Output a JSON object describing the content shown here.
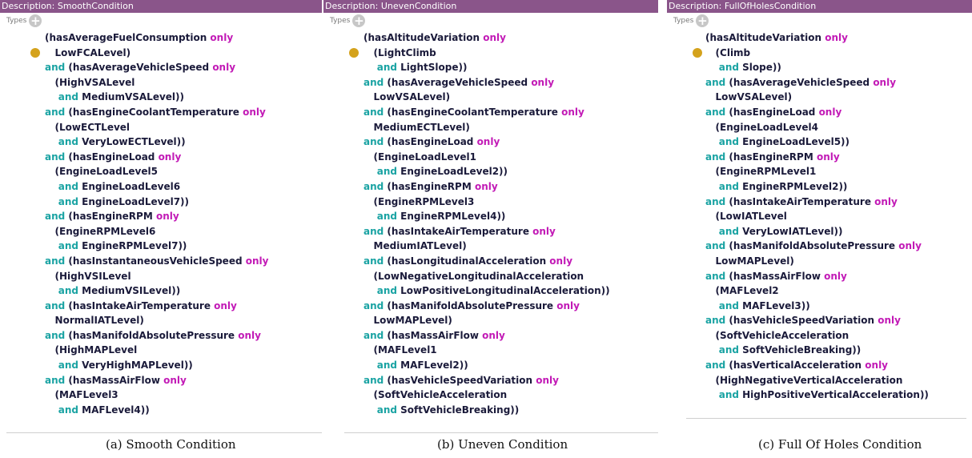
{
  "panels": [
    {
      "header": "Description: SmoothCondition",
      "types_label": "Types",
      "add_icon": "plus-circle-icon",
      "bullet_icon": "class-dot-icon",
      "lines": [
        [
          {
            "t": "(hasAverageFuelConsumption "
          },
          {
            "t": "only",
            "k": "only"
          }
        ],
        [
          {
            "t": "   LowFCALevel)"
          }
        ],
        [
          {
            "t": "and",
            "k": "and"
          },
          {
            "t": " (hasAverageVehicleSpeed "
          },
          {
            "t": "only",
            "k": "only"
          }
        ],
        [
          {
            "t": "   (HighVSALevel"
          }
        ],
        [
          {
            "t": "    "
          },
          {
            "t": "and",
            "k": "and"
          },
          {
            "t": " MediumVSALevel))"
          }
        ],
        [
          {
            "t": "and",
            "k": "and"
          },
          {
            "t": " (hasEngineCoolantTemperature "
          },
          {
            "t": "only",
            "k": "only"
          }
        ],
        [
          {
            "t": "   (LowECTLevel"
          }
        ],
        [
          {
            "t": "    "
          },
          {
            "t": "and",
            "k": "and"
          },
          {
            "t": " VeryLowECTLevel))"
          }
        ],
        [
          {
            "t": "and",
            "k": "and"
          },
          {
            "t": " (hasEngineLoad "
          },
          {
            "t": "only",
            "k": "only"
          }
        ],
        [
          {
            "t": "   (EngineLoadLevel5"
          }
        ],
        [
          {
            "t": "    "
          },
          {
            "t": "and",
            "k": "and"
          },
          {
            "t": " EngineLoadLevel6"
          }
        ],
        [
          {
            "t": "    "
          },
          {
            "t": "and",
            "k": "and"
          },
          {
            "t": " EngineLoadLevel7))"
          }
        ],
        [
          {
            "t": "and",
            "k": "and"
          },
          {
            "t": " (hasEngineRPM "
          },
          {
            "t": "only",
            "k": "only"
          }
        ],
        [
          {
            "t": "   (EngineRPMLevel6"
          }
        ],
        [
          {
            "t": "    "
          },
          {
            "t": "and",
            "k": "and"
          },
          {
            "t": " EngineRPMLevel7))"
          }
        ],
        [
          {
            "t": "and",
            "k": "and"
          },
          {
            "t": " (hasInstantaneousVehicleSpeed "
          },
          {
            "t": "only",
            "k": "only"
          }
        ],
        [
          {
            "t": "   (HighVSILevel"
          }
        ],
        [
          {
            "t": "    "
          },
          {
            "t": "and",
            "k": "and"
          },
          {
            "t": " MediumVSILevel))"
          }
        ],
        [
          {
            "t": "and",
            "k": "and"
          },
          {
            "t": " (hasIntakeAirTemperature "
          },
          {
            "t": "only",
            "k": "only"
          }
        ],
        [
          {
            "t": "   NormalIATLevel)"
          }
        ],
        [
          {
            "t": "and",
            "k": "and"
          },
          {
            "t": " (hasManifoldAbsolutePressure "
          },
          {
            "t": "only",
            "k": "only"
          }
        ],
        [
          {
            "t": "   (HighMAPLevel"
          }
        ],
        [
          {
            "t": "    "
          },
          {
            "t": "and",
            "k": "and"
          },
          {
            "t": " VeryHighMAPLevel))"
          }
        ],
        [
          {
            "t": "and",
            "k": "and"
          },
          {
            "t": " (hasMassAirFlow "
          },
          {
            "t": "only",
            "k": "only"
          }
        ],
        [
          {
            "t": "   (MAFLevel3"
          }
        ],
        [
          {
            "t": "    "
          },
          {
            "t": "and",
            "k": "and"
          },
          {
            "t": " MAFLevel4))"
          }
        ]
      ],
      "caption": "(a)  Smooth Condition"
    },
    {
      "header": "Description: UnevenCondition",
      "types_label": "Types",
      "add_icon": "plus-circle-icon",
      "bullet_icon": "class-dot-icon",
      "lines": [
        [
          {
            "t": "(hasAltitudeVariation "
          },
          {
            "t": "only",
            "k": "only"
          }
        ],
        [
          {
            "t": "   (LightClimb"
          }
        ],
        [
          {
            "t": "    "
          },
          {
            "t": "and",
            "k": "and"
          },
          {
            "t": " LightSlope))"
          }
        ],
        [
          {
            "t": "and",
            "k": "and"
          },
          {
            "t": " (hasAverageVehicleSpeed "
          },
          {
            "t": "only",
            "k": "only"
          }
        ],
        [
          {
            "t": "   LowVSALevel)"
          }
        ],
        [
          {
            "t": "and",
            "k": "and"
          },
          {
            "t": " (hasEngineCoolantTemperature "
          },
          {
            "t": "only",
            "k": "only"
          }
        ],
        [
          {
            "t": "   MediumECTLevel)"
          }
        ],
        [
          {
            "t": "and",
            "k": "and"
          },
          {
            "t": " (hasEngineLoad "
          },
          {
            "t": "only",
            "k": "only"
          }
        ],
        [
          {
            "t": "   (EngineLoadLevel1"
          }
        ],
        [
          {
            "t": "    "
          },
          {
            "t": "and",
            "k": "and"
          },
          {
            "t": " EngineLoadLevel2))"
          }
        ],
        [
          {
            "t": "and",
            "k": "and"
          },
          {
            "t": " (hasEngineRPM "
          },
          {
            "t": "only",
            "k": "only"
          }
        ],
        [
          {
            "t": "   (EngineRPMLevel3"
          }
        ],
        [
          {
            "t": "    "
          },
          {
            "t": "and",
            "k": "and"
          },
          {
            "t": " EngineRPMLevel4))"
          }
        ],
        [
          {
            "t": "and",
            "k": "and"
          },
          {
            "t": " (hasIntakeAirTemperature "
          },
          {
            "t": "only",
            "k": "only"
          }
        ],
        [
          {
            "t": "   MediumIATLevel)"
          }
        ],
        [
          {
            "t": "and",
            "k": "and"
          },
          {
            "t": " (hasLongitudinalAcceleration "
          },
          {
            "t": "only",
            "k": "only"
          }
        ],
        [
          {
            "t": "   (LowNegativeLongitudinalAcceleration"
          }
        ],
        [
          {
            "t": "    "
          },
          {
            "t": "and",
            "k": "and"
          },
          {
            "t": " LowPositiveLongitudinalAcceleration))"
          }
        ],
        [
          {
            "t": "and",
            "k": "and"
          },
          {
            "t": " (hasManifoldAbsolutePressure "
          },
          {
            "t": "only",
            "k": "only"
          }
        ],
        [
          {
            "t": "   LowMAPLevel)"
          }
        ],
        [
          {
            "t": "and",
            "k": "and"
          },
          {
            "t": " (hasMassAirFlow "
          },
          {
            "t": "only",
            "k": "only"
          }
        ],
        [
          {
            "t": "   (MAFLevel1"
          }
        ],
        [
          {
            "t": "    "
          },
          {
            "t": "and",
            "k": "and"
          },
          {
            "t": " MAFLevel2))"
          }
        ],
        [
          {
            "t": "and",
            "k": "and"
          },
          {
            "t": " (hasVehicleSpeedVariation "
          },
          {
            "t": "only",
            "k": "only"
          }
        ],
        [
          {
            "t": "   (SoftVehicleAcceleration"
          }
        ],
        [
          {
            "t": "    "
          },
          {
            "t": "and",
            "k": "and"
          },
          {
            "t": " SoftVehicleBreaking))"
          }
        ]
      ],
      "caption": "(b)  Uneven Condition"
    },
    {
      "header": "Description: FullOfHolesCondition",
      "types_label": "Types",
      "add_icon": "plus-circle-icon",
      "bullet_icon": "class-dot-icon",
      "lines": [
        [
          {
            "t": "(hasAltitudeVariation "
          },
          {
            "t": "only",
            "k": "only"
          }
        ],
        [
          {
            "t": "   (Climb"
          }
        ],
        [
          {
            "t": "    "
          },
          {
            "t": "and",
            "k": "and"
          },
          {
            "t": " Slope))"
          }
        ],
        [
          {
            "t": "and",
            "k": "and"
          },
          {
            "t": " (hasAverageVehicleSpeed "
          },
          {
            "t": "only",
            "k": "only"
          }
        ],
        [
          {
            "t": "   LowVSALevel)"
          }
        ],
        [
          {
            "t": "and",
            "k": "and"
          },
          {
            "t": " (hasEngineLoad "
          },
          {
            "t": "only",
            "k": "only"
          }
        ],
        [
          {
            "t": "   (EngineLoadLevel4"
          }
        ],
        [
          {
            "t": "    "
          },
          {
            "t": "and",
            "k": "and"
          },
          {
            "t": " EngineLoadLevel5))"
          }
        ],
        [
          {
            "t": "and",
            "k": "and"
          },
          {
            "t": " (hasEngineRPM "
          },
          {
            "t": "only",
            "k": "only"
          }
        ],
        [
          {
            "t": "   (EngineRPMLevel1"
          }
        ],
        [
          {
            "t": "    "
          },
          {
            "t": "and",
            "k": "and"
          },
          {
            "t": " EngineRPMLevel2))"
          }
        ],
        [
          {
            "t": "and",
            "k": "and"
          },
          {
            "t": " (hasIntakeAirTemperature "
          },
          {
            "t": "only",
            "k": "only"
          }
        ],
        [
          {
            "t": "   (LowIATLevel"
          }
        ],
        [
          {
            "t": "    "
          },
          {
            "t": "and",
            "k": "and"
          },
          {
            "t": " VeryLowIATLevel))"
          }
        ],
        [
          {
            "t": "and",
            "k": "and"
          },
          {
            "t": " (hasManifoldAbsolutePressure "
          },
          {
            "t": "only",
            "k": "only"
          }
        ],
        [
          {
            "t": "   LowMAPLevel)"
          }
        ],
        [
          {
            "t": "and",
            "k": "and"
          },
          {
            "t": " (hasMassAirFlow "
          },
          {
            "t": "only",
            "k": "only"
          }
        ],
        [
          {
            "t": "   (MAFLevel2"
          }
        ],
        [
          {
            "t": "    "
          },
          {
            "t": "and",
            "k": "and"
          },
          {
            "t": " MAFLevel3))"
          }
        ],
        [
          {
            "t": "and",
            "k": "and"
          },
          {
            "t": " (hasVehicleSpeedVariation "
          },
          {
            "t": "only",
            "k": "only"
          }
        ],
        [
          {
            "t": "   (SoftVehicleAcceleration"
          }
        ],
        [
          {
            "t": "    "
          },
          {
            "t": "and",
            "k": "and"
          },
          {
            "t": " SoftVehicleBreaking))"
          }
        ],
        [
          {
            "t": "and",
            "k": "and"
          },
          {
            "t": " (hasVerticalAcceleration "
          },
          {
            "t": "only",
            "k": "only"
          }
        ],
        [
          {
            "t": "   (HighNegativeVerticalAcceleration"
          }
        ],
        [
          {
            "t": "    "
          },
          {
            "t": "and",
            "k": "and"
          },
          {
            "t": " HighPositiveVerticalAcceleration))"
          }
        ]
      ],
      "caption": "(c)  Full Of Holes Condition"
    }
  ],
  "colors": {
    "header_bg": "#8a558a",
    "keyword_and": "#1aa3a3",
    "keyword_only": "#c21ab6",
    "bullet": "#d4a21c"
  }
}
